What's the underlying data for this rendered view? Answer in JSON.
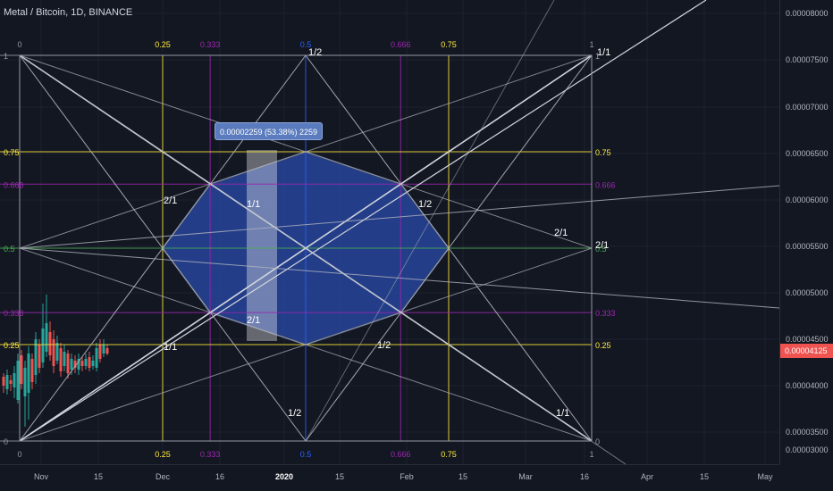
{
  "title": "Metal / Bitcoin, 1D, BINANCE",
  "tooltip": "0.00002259 (53.38%) 2259",
  "price_tag": "0.00004125",
  "y_axis": [
    "0.00008000",
    "0.00007500",
    "0.00007000",
    "0.00006500",
    "0.00006000",
    "0.00005500",
    "0.00005000",
    "0.00004500",
    "0.00004000",
    "0.00003500",
    "0.00003000"
  ],
  "x_axis": [
    {
      "label": "Nov",
      "bold": false
    },
    {
      "label": "15",
      "bold": false
    },
    {
      "label": "Dec",
      "bold": false
    },
    {
      "label": "16",
      "bold": false
    },
    {
      "label": "2020",
      "bold": true
    },
    {
      "label": "15",
      "bold": false
    },
    {
      "label": "Feb",
      "bold": false
    },
    {
      "label": "15",
      "bold": false
    },
    {
      "label": "Mar",
      "bold": false
    },
    {
      "label": "16",
      "bold": false
    },
    {
      "label": "Apr",
      "bold": false
    },
    {
      "label": "15",
      "bold": false
    },
    {
      "label": "May",
      "bold": false
    }
  ],
  "fib_labels": [
    "0",
    "0.25",
    "0.333",
    "0.5",
    "0.666",
    "0.75",
    "1"
  ],
  "angle_labels": {
    "half": "1/2",
    "one": "1/1",
    "two": "2/1"
  },
  "colors": {
    "background": "#131722",
    "yellow": "#ffeb3b",
    "purple": "#9c27b0",
    "blue": "#2962ff",
    "green": "#4caf50",
    "grey": "#9598a1",
    "polygon_fill": "#2b50b8",
    "tooltip": "#5a7bbd",
    "price_tag": "#ef5350",
    "candle_up": "#26a69a",
    "candle_down": "#ef5350"
  }
}
